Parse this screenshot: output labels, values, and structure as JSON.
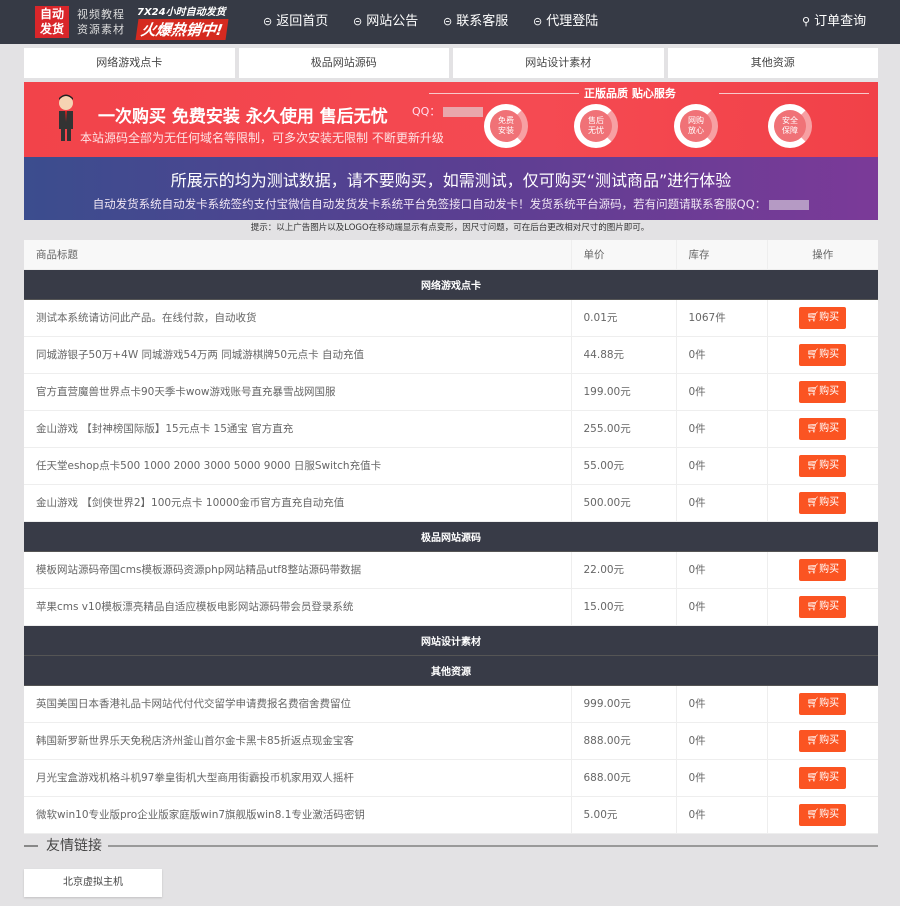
{
  "header": {
    "logo": "自动发货",
    "logo_sub1": "视频教程",
    "logo_sub2": "资源素材",
    "promo_line1": "7X24小时自动发货",
    "promo_line2": "火爆热销中!",
    "nav": [
      {
        "label": "返回首页"
      },
      {
        "label": "网站公告"
      },
      {
        "label": "联系客服"
      },
      {
        "label": "代理登陆"
      }
    ],
    "order_query": "订单查询"
  },
  "categories": [
    "网络游戏点卡",
    "极品网站源码",
    "网站设计素材",
    "其他资源"
  ],
  "banner": {
    "headline": "一次购买  免费安装  永久使用  售后无忧",
    "qq_label": "QQ：",
    "subline": "本站源码全部为无任何域名等限制，可多次安装无限制  不断更新升级",
    "service_title": "正版品质 贴心服务",
    "rings": [
      "免费安装",
      "售后无忧",
      "网购放心",
      "安全保障"
    ],
    "notice_title": "所展示的均为测试数据，请不要购买，如需测试，仅可购买“测试商品”进行体验",
    "notice_sub": "自动发货系统自动发卡系统签约支付宝微信自动发货发卡系统平台免签接口自动发卡！发货系统平台源码，若有问题请联系客服QQ："
  },
  "tip": "提示：以上广告图片以及LOGO在移动端显示有点变形，因尺寸问题，可在后台更改相对尺寸的图片即可。",
  "table": {
    "headers": [
      "商品标题",
      "单价",
      "库存",
      "操作"
    ],
    "buy_label": "购买",
    "groups": [
      {
        "name": "网络游戏点卡",
        "rows": [
          {
            "title": "测试本系统请访问此产品。在线付款，自动收货",
            "price": "0.01元",
            "stock": "1067件"
          },
          {
            "title": "同城游银子50万+4W 同城游戏54万两 同城游棋牌50元点卡 自动充值",
            "price": "44.88元",
            "stock": "0件"
          },
          {
            "title": "官方直营魔兽世界点卡90天季卡wow游戏账号直充暴雪战网国服",
            "price": "199.00元",
            "stock": "0件"
          },
          {
            "title": "金山游戏 【封神榜国际版】15元点卡 15通宝 官方直充",
            "price": "255.00元",
            "stock": "0件"
          },
          {
            "title": "任天堂eshop点卡500 1000 2000 3000 5000 9000 日服Switch充值卡",
            "price": "55.00元",
            "stock": "0件"
          },
          {
            "title": "金山游戏 【剑侠世界2】100元点卡 10000金币官方直充自动充值",
            "price": "500.00元",
            "stock": "0件"
          }
        ]
      },
      {
        "name": "极品网站源码",
        "rows": [
          {
            "title": "模板网站源码帝国cms模板源码资源php网站精品utf8整站源码带数据",
            "price": "22.00元",
            "stock": "0件"
          },
          {
            "title": "苹果cms v10模板漂亮精品自适应模板电影网站源码带会员登录系统",
            "price": "15.00元",
            "stock": "0件"
          }
        ]
      },
      {
        "name": "网站设计素材",
        "rows": []
      },
      {
        "name": "其他资源",
        "rows": [
          {
            "title": "英国美国日本香港礼品卡网站代付代交留学申请费报名费宿舍费留位",
            "price": "999.00元",
            "stock": "0件"
          },
          {
            "title": "韩国新罗新世界乐天免税店济州釜山首尔金卡黑卡85折返点现金宝客",
            "price": "888.00元",
            "stock": "0件"
          },
          {
            "title": "月光宝盒游戏机格斗机97拳皇街机大型商用街霸投币机家用双人摇杆",
            "price": "688.00元",
            "stock": "0件"
          },
          {
            "title": "微软win10专业版pro企业版家庭版win7旗舰版win8.1专业激活码密钥",
            "price": "5.00元",
            "stock": "0件"
          }
        ]
      }
    ]
  },
  "friends": {
    "title": "友情链接",
    "links": [
      "北京虚拟主机"
    ]
  }
}
